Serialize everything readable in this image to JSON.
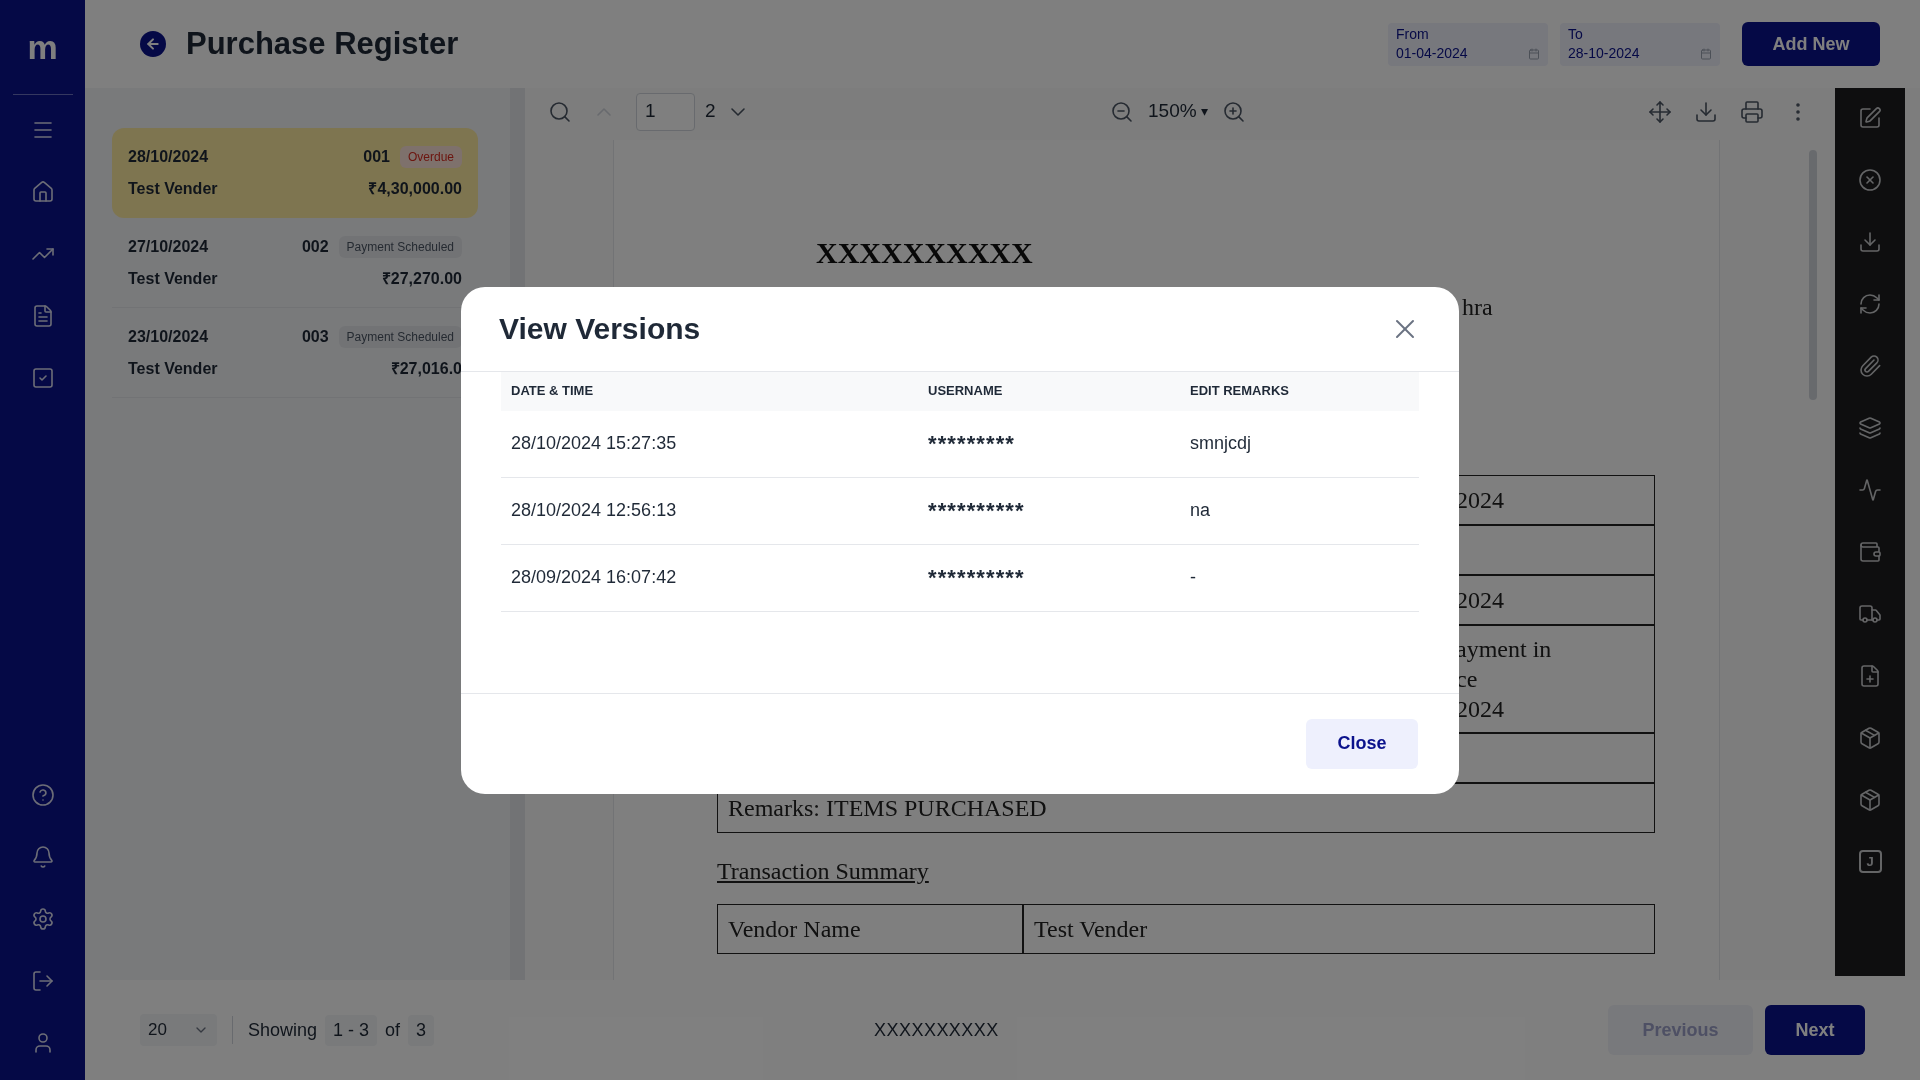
{
  "sidebar": {
    "logo": "m"
  },
  "header": {
    "title": "Purchase Register",
    "date_from": {
      "label": "From",
      "value": "01-04-2024"
    },
    "date_to": {
      "label": "To",
      "value": "28-10-2024"
    },
    "add_button": "Add New"
  },
  "register_list": [
    {
      "date": "28/10/2024",
      "number": "001",
      "status": {
        "label": "Overdue",
        "kind": "overdue"
      },
      "vendor": "Test Vender",
      "amount": "₹4,30,000.00",
      "selected": true
    },
    {
      "date": "27/10/2024",
      "number": "002",
      "status": {
        "label": "Payment Scheduled",
        "kind": "scheduled"
      },
      "vendor": "Test Vender",
      "amount": "₹27,270.00",
      "selected": false
    },
    {
      "date": "23/10/2024",
      "number": "003",
      "status": {
        "label": "Payment Scheduled",
        "kind": "scheduled"
      },
      "vendor": "Test Vender",
      "amount": "₹27,016.0",
      "selected": false
    }
  ],
  "viewer": {
    "prev_page_disabled": true,
    "page_input": "1",
    "page_count": "2",
    "zoom": "150%",
    "zoom_caret": "▾"
  },
  "document": {
    "heading": "XXXXXXXXXX",
    "address_fragment": "hra",
    "rows": [
      {
        "kind": "text",
        "lines": [
          "2024"
        ]
      },
      {
        "kind": "blank"
      },
      {
        "kind": "text",
        "lines": [
          "2024"
        ]
      },
      {
        "kind": "text",
        "lines": [
          "ayment in",
          "ce",
          "2024"
        ]
      },
      {
        "kind": "split3"
      },
      {
        "kind": "full",
        "text": "Remarks: ITEMS PURCHASED"
      }
    ],
    "summary_title": "Transaction Summary",
    "summary_rows": [
      [
        "Vendor Name",
        "Test Vender"
      ]
    ]
  },
  "right_toolbar": {
    "journal_letter": "J"
  },
  "footer": {
    "page_size": "20",
    "showing_label": "Showing",
    "range": "1 - 3",
    "of_label": "of",
    "total": "3",
    "center_text": "XXXXXXXXXX",
    "previous": {
      "label": "Previous",
      "disabled": true
    },
    "next": "Next"
  },
  "modal": {
    "title": "View Versions",
    "columns": [
      "DATE & TIME",
      "USERNAME",
      "EDIT REMARKS"
    ],
    "rows": [
      [
        "28/10/2024 15:27:35",
        "*********",
        "smnjcdj"
      ],
      [
        "28/10/2024 12:56:13",
        "**********",
        "na"
      ],
      [
        "28/09/2024 16:07:42",
        "**********",
        "-"
      ]
    ],
    "close_button": "Close"
  }
}
